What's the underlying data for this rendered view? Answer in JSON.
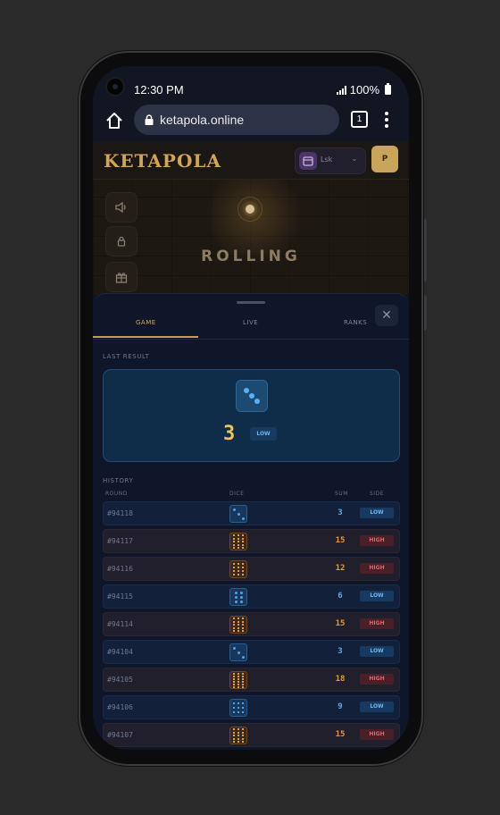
{
  "status_bar": {
    "time": "12:30 PM",
    "battery": "100%"
  },
  "browser": {
    "url": "ketapola.online",
    "tab_count": "1"
  },
  "site": {
    "logo": "KETAPOLA",
    "wallet_label": "Lsk",
    "profile_initial": "P"
  },
  "stage": {
    "status": "ROLLING"
  },
  "sheet": {
    "tabs": [
      "GAME",
      "LIVE",
      "RANKS"
    ],
    "active_tab": "GAME",
    "last_result_label": "LAST RESULT",
    "last_result": {
      "die_face": 3,
      "sum": "3",
      "side": "LOW"
    },
    "history_label": "HISTORY",
    "columns": {
      "round": "ROUND",
      "dice": "DICE",
      "sum": "SUM",
      "side": "SIDE"
    },
    "history": [
      {
        "round": "#94118",
        "die_face": 3,
        "sum": "3",
        "side": "LOW"
      },
      {
        "round": "#94117",
        "die_face": 15,
        "sum": "15",
        "side": "HIGH"
      },
      {
        "round": "#94116",
        "die_face": 12,
        "sum": "12",
        "side": "HIGH"
      },
      {
        "round": "#94115",
        "die_face": 6,
        "sum": "6",
        "side": "LOW"
      },
      {
        "round": "#94114",
        "die_face": 15,
        "sum": "15",
        "side": "HIGH"
      },
      {
        "round": "#94104",
        "die_face": 3,
        "sum": "3",
        "side": "LOW"
      },
      {
        "round": "#94105",
        "die_face": 18,
        "sum": "18",
        "side": "HIGH"
      },
      {
        "round": "#94106",
        "die_face": 9,
        "sum": "9",
        "side": "LOW"
      },
      {
        "round": "#94107",
        "die_face": 15,
        "sum": "15",
        "side": "HIGH"
      }
    ]
  },
  "colors": {
    "accent": "#d0a55c",
    "low": "#5fa8e6",
    "high": "#e2994a"
  }
}
